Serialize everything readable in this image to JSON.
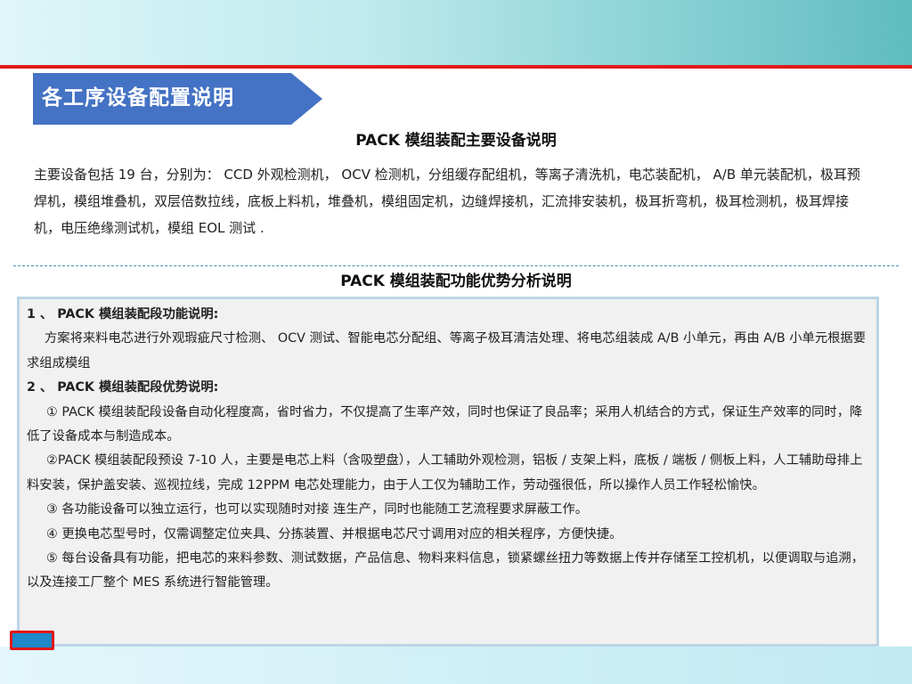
{
  "header": {
    "section_title": "各工序设备配置说明"
  },
  "equipment": {
    "title": "PACK 模组装配主要设备说明",
    "description": "主要设备包括 19 台，分别为： CCD 外观检测机， OCV 检测机，分组缓存配组机，等离子清洗机，电芯装配机， A/B 单元装配机，极耳预焊机，模组堆叠机，双层倍数拉线，底板上料机，堆叠机，模组固定机，边缝焊接机，汇流排安装机，极耳折弯机，极耳检测机，极耳焊接机，电压绝缘测试机，模组 EOL 测试 ."
  },
  "analysis": {
    "title": "PACK 模组装配功能优势分析说明",
    "function_heading": "1 、 PACK 模组装配段功能说明:",
    "function_text": "方案将来料电芯进行外观瑕疵尺寸检测、 OCV 测试、智能电芯分配组、等离子极耳清洁处理、将电芯组装成 A/B 小单元，再由 A/B 小单元根据要求组成模组",
    "advantage_heading": "2 、 PACK 模组装配段优势说明:",
    "advantages": [
      "① PACK 模组装配段设备自动化程度高，省时省力，不仅提高了生率产效，同时也保证了良品率；采用人机结合的方式，保证生产效率的同时，降低了设备成本与制造成本。",
      "②PACK 模组装配段预设 7-10 人，主要是电芯上料（含吸塑盘），人工辅助外观检测，铝板 / 支架上料，底板 / 端板 / 侧板上料，人工辅助母排上料安装，保护盖安装、巡视拉线，完成 12PPM 电芯处理能力，由于人工仅为辅助工作，劳动强很低，所以操作人员工作轻松愉快。",
      "③ 各功能设备可以独立运行，也可以实现随时对接 连生产，同时也能随工艺流程要求屏蔽工作。",
      "④  更换电芯型号时，仅需调整定位夹具、分拣装置、并根据电芯尺寸调用对应的相关程序，方便快捷。",
      "⑤ 每台设备具有功能，把电芯的来料参数、测试数据，产品信息、物料来料信息，锁紧螺丝扭力等数据上传并存储至工控机机，以便调取与追溯，以及连接工厂整个 MES 系统进行智能管理。"
    ]
  },
  "colors": {
    "banner": "#4472c4",
    "accent_rule": "#e21b1b",
    "panel_border": "#bcd5e6"
  }
}
